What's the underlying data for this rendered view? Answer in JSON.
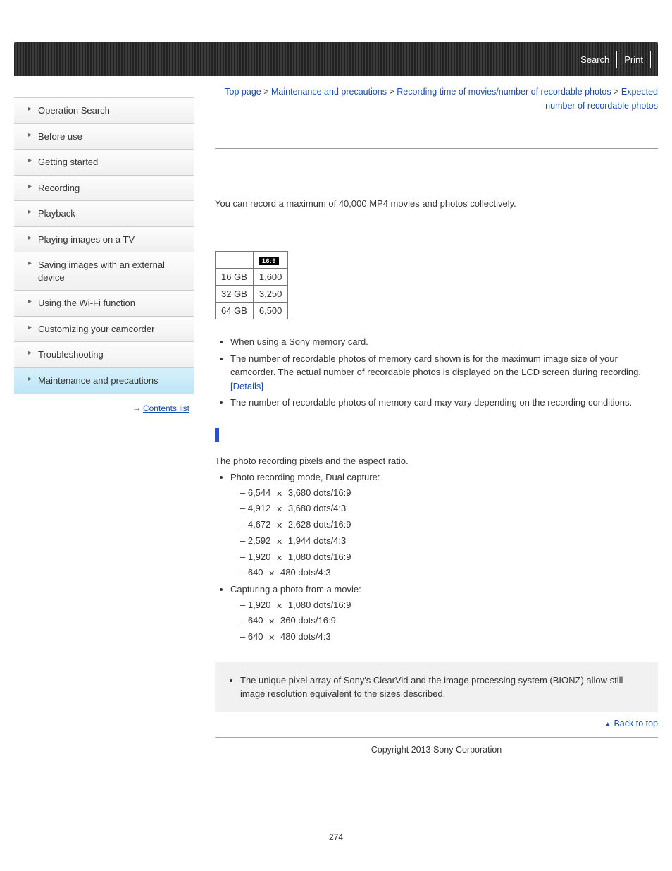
{
  "header": {
    "search": "Search",
    "print": "Print"
  },
  "breadcrumb": {
    "top": "Top page",
    "b1": "Maintenance and precautions",
    "b2": "Recording time of movies/number of recordable photos",
    "b3": "Expected number of recordable photos"
  },
  "sidebar": {
    "items": [
      "Operation Search",
      "Before use",
      "Getting started",
      "Recording",
      "Playback",
      "Playing images on a TV",
      "Saving images with an external device",
      "Using the Wi-Fi function",
      "Customizing your camcorder",
      "Troubleshooting",
      "Maintenance and precautions"
    ],
    "contents_list": "Contents list"
  },
  "intro": "You can record a maximum of 40,000 MP4 movies and photos collectively.",
  "table": {
    "header_ratio": "16:9",
    "rows": [
      {
        "cap": "16 GB",
        "val": "1,600"
      },
      {
        "cap": "32 GB",
        "val": "3,250"
      },
      {
        "cap": "64 GB",
        "val": "6,500"
      }
    ]
  },
  "notes1": {
    "n1": "When using a Sony memory card.",
    "n2a": "The number of recordable photos of memory card shown is for the maximum image size of your camcorder. The actual number of recordable photos is displayed on the LCD screen during recording. ",
    "n2link": "[Details]",
    "n3": "The number of recordable photos of memory card may vary depending on the recording conditions."
  },
  "pixels": {
    "lead": "The photo recording pixels and the aspect ratio.",
    "mode1_label": "Photo recording mode, Dual capture:",
    "mode1": [
      {
        "a": "6,544",
        "b": "3,680 dots/16:9"
      },
      {
        "a": "4,912",
        "b": "3,680 dots/4:3"
      },
      {
        "a": "4,672",
        "b": "2,628 dots/16:9"
      },
      {
        "a": "2,592",
        "b": "1,944 dots/4:3"
      },
      {
        "a": "1,920",
        "b": "1,080 dots/16:9"
      },
      {
        "a": "640",
        "b": "480 dots/4:3"
      }
    ],
    "mode2_label": "Capturing a photo from a movie:",
    "mode2": [
      {
        "a": "1,920",
        "b": "1,080 dots/16:9"
      },
      {
        "a": "640",
        "b": "360 dots/16:9"
      },
      {
        "a": "640",
        "b": "480 dots/4:3"
      }
    ]
  },
  "notebox": "The unique pixel array of Sony's ClearVid and the image processing system (BIONZ) allow still image resolution equivalent to the sizes described.",
  "backtop": "Back to top",
  "footer": "Copyright 2013 Sony Corporation",
  "pagenum": "274"
}
